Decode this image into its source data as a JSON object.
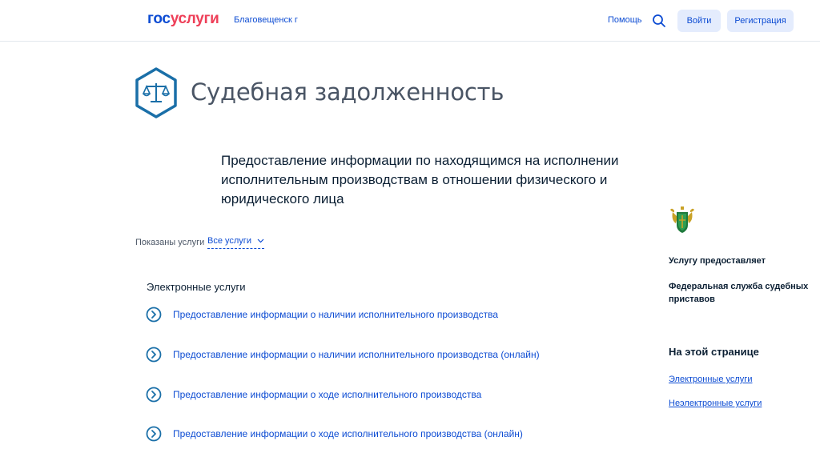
{
  "header": {
    "logo_part1": "гос",
    "logo_part2": "услуги",
    "city": "Благовещенск г",
    "help": "Помощь",
    "login": "Войти",
    "register": "Регистрация"
  },
  "page": {
    "title": "Судебная задолженность",
    "subtitle": "Предоставление информации по находящимся на исполнении исполнительным производствам в отношении физического и юридического лица"
  },
  "filter": {
    "label": "Показаны услуги",
    "value": "Все услуги"
  },
  "services": {
    "section_title": "Электронные услуги",
    "items": [
      "Предоставление информации о наличии исполнительного производства",
      "Предоставление информации о наличии исполнительного производства (онлайн)",
      "Предоставление информации о ходе исполнительного производства",
      "Предоставление информации о ходе исполнительного производства (онлайн)"
    ]
  },
  "sidebar": {
    "provider_label": "Услугу предоставляет",
    "provider_name": "Федеральная служба судебных приставов",
    "onpage_title": "На этой странице",
    "links": [
      "Электронные услуги",
      "Неэлектронные услуги"
    ]
  },
  "colors": {
    "brand_blue": "#0d4cd3",
    "brand_red": "#ee3f58",
    "icon_blue": "#1a6fa8"
  },
  "icons": {
    "search": "search-icon",
    "title": "scales-icon",
    "emblem": "fssp-emblem-icon",
    "item": "circle-chevron-right-icon"
  }
}
